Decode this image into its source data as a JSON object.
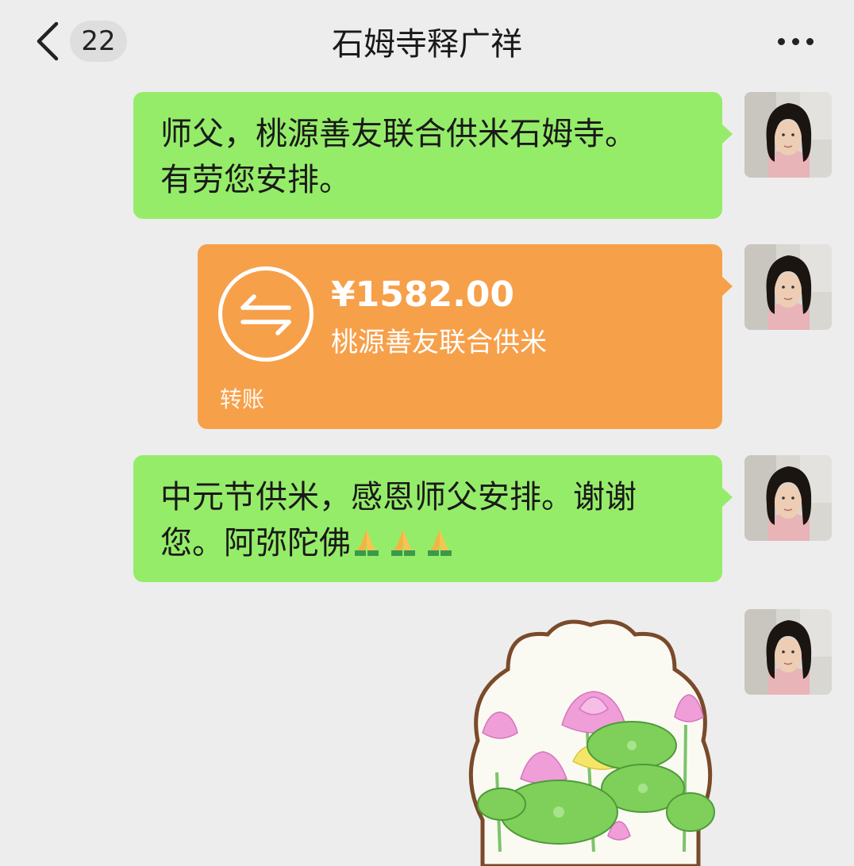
{
  "header": {
    "title": "石姆寺释广祥",
    "unread_count": "22",
    "back_icon": "chevron-left-icon",
    "more_icon": "more-dots-icon"
  },
  "messages": [
    {
      "type": "text",
      "lines": [
        "师父，桃源善友联合供米石姆寺。",
        "有劳您安排。"
      ]
    },
    {
      "type": "transfer",
      "amount": "¥1582.00",
      "note": "桃源善友联合供米",
      "label": "转账",
      "color": "#f6a04a"
    },
    {
      "type": "text",
      "lines": [
        "中元节供米，感恩师父安排。谢谢",
        "您。阿弥陀佛"
      ],
      "emoji": [
        "folded-hands-icon",
        "folded-hands-icon",
        "folded-hands-icon"
      ]
    },
    {
      "type": "sticker",
      "icon": "lotus-sticker"
    }
  ],
  "colors": {
    "background": "#ededed",
    "bubble_self": "#95ec69",
    "transfer": "#f6a04a"
  }
}
